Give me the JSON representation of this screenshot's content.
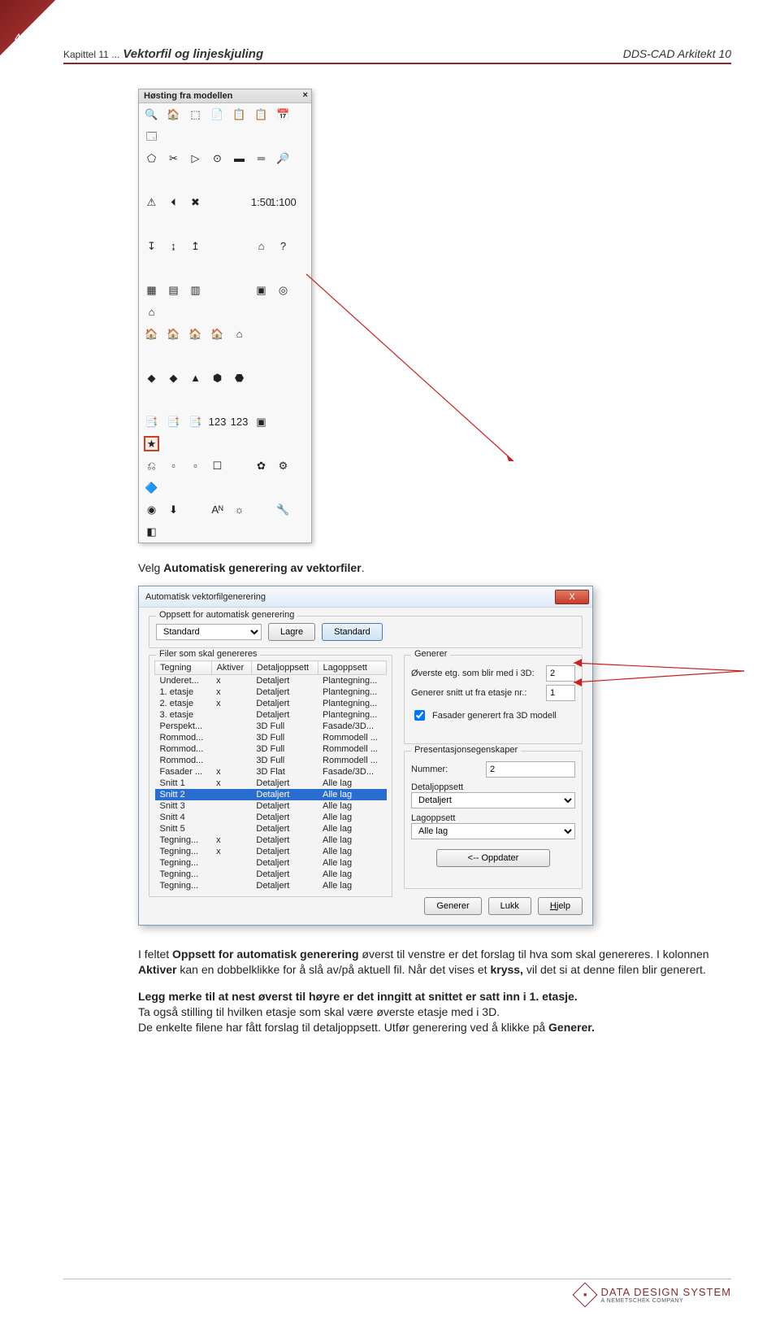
{
  "page_number": "4",
  "header": {
    "chapter": "Kapittel 11 ...",
    "title": "Vektorfil og linjeskjuling",
    "right": "DDS-CAD Arkitekt 10"
  },
  "toolbox": {
    "title": "Høsting fra modellen",
    "close": "×",
    "rows": [
      [
        "🔍",
        "🏠",
        "⬚",
        "📄",
        "📋",
        "📋",
        "📅",
        "🗔"
      ],
      [
        "⬠",
        "✂",
        "▷",
        "⊙",
        "▬",
        "═",
        "🔎",
        " "
      ],
      [
        "⚠",
        "⏴",
        "✖",
        " ",
        " ",
        "1:50",
        "1:100",
        " "
      ],
      [
        "↧",
        "↨",
        "↥",
        " ",
        " ",
        "⌂",
        "?",
        " "
      ],
      [
        "▦",
        "▤",
        "▥",
        " ",
        " ",
        "▣",
        "◎",
        "⌂"
      ],
      [
        "🏠",
        "🏠",
        "🏠",
        "🏠",
        "⌂",
        " ",
        " ",
        " "
      ],
      [
        "◆",
        "◆",
        "▲",
        "⬢",
        "⬣",
        " ",
        " ",
        " "
      ],
      [
        "📑",
        "📑",
        "📑",
        "123",
        "123",
        "▣",
        " ",
        "★"
      ],
      [
        "⎌",
        "▫",
        "▫",
        "☐",
        " ",
        "✿",
        "⚙",
        "🔷"
      ],
      [
        "◉",
        "⬇",
        " ",
        "Aᴺ",
        "☼",
        " ",
        "🔧",
        "◧"
      ]
    ],
    "highlight_index": [
      7,
      7
    ]
  },
  "caption_1": {
    "pre": "Velg ",
    "bold": "Automatisk generering av vektorfiler",
    "post": "."
  },
  "dialog": {
    "title": "Automatisk vektorfilgenerering",
    "close": "X",
    "gb_oppsett": "Oppsett for automatisk generering",
    "combo_standard": "Standard",
    "btn_lagre": "Lagre",
    "btn_standard": "Standard",
    "gb_filer": "Filer som skal genereres",
    "cols": [
      "Tegning",
      "Aktiver",
      "Detaljoppsett",
      "Lagoppsett"
    ],
    "rows": [
      [
        "Underet...",
        "x",
        "Detaljert",
        "Plantegning..."
      ],
      [
        "1. etasje",
        "x",
        "Detaljert",
        "Plantegning..."
      ],
      [
        "2. etasje",
        "x",
        "Detaljert",
        "Plantegning..."
      ],
      [
        "3. etasje",
        "",
        "Detaljert",
        "Plantegning..."
      ],
      [
        "Perspekt...",
        "",
        "3D Full",
        "Fasade/3D..."
      ],
      [
        "Rommod...",
        "",
        "3D Full",
        "Rommodell ..."
      ],
      [
        "Rommod...",
        "",
        "3D Full",
        "Rommodell ..."
      ],
      [
        "Rommod...",
        "",
        "3D Full",
        "Rommodell ..."
      ],
      [
        "Fasader ...",
        "x",
        "3D Flat",
        "Fasade/3D..."
      ],
      [
        "Snitt 1",
        "x",
        "Detaljert",
        "Alle lag"
      ],
      [
        "Snitt 2",
        "",
        "Detaljert",
        "Alle lag"
      ],
      [
        "Snitt 3",
        "",
        "Detaljert",
        "Alle lag"
      ],
      [
        "Snitt 4",
        "",
        "Detaljert",
        "Alle lag"
      ],
      [
        "Snitt 5",
        "",
        "Detaljert",
        "Alle lag"
      ],
      [
        "Tegning...",
        "x",
        "Detaljert",
        "Alle lag"
      ],
      [
        "Tegning...",
        "x",
        "Detaljert",
        "Alle lag"
      ],
      [
        "Tegning...",
        "",
        "Detaljert",
        "Alle lag"
      ],
      [
        "Tegning...",
        "",
        "Detaljert",
        "Alle lag"
      ],
      [
        "Tegning...",
        "",
        "Detaljert",
        "Alle lag"
      ]
    ],
    "selected_row_index": 10,
    "gb_generer": "Generer",
    "lbl_overste": "Øverste etg. som blir med i 3D:",
    "val_overste": "2",
    "lbl_snitt": "Generer snitt ut fra etasje nr.:",
    "val_snitt": "1",
    "chk_fasader": "Fasader generert fra 3D modell",
    "gb_pres": "Presentasjonsegenskaper",
    "lbl_nummer": "Nummer:",
    "val_nummer": "2",
    "lbl_detaljopp": "Detaljoppsett",
    "combo_detaljopp": "Detaljert",
    "lbl_lagopp": "Lagoppsett",
    "combo_lagopp": "Alle lag",
    "btn_oppdater": "<-- Oppdater",
    "btn_generer": "Generer",
    "btn_lukk": "Lukk",
    "btn_hjelp": "Hjelp"
  },
  "body": {
    "p1_a": "I feltet ",
    "p1_b": "Oppsett for automatisk generering",
    "p1_c": " øverst til venstre er det forslag til hva som skal genereres. I kolonnen ",
    "p1_d": "Aktiver",
    "p1_e": " kan en dobbelklikke for å slå av/på aktuell fil. Når det vises et ",
    "p1_f": "kryss,",
    "p1_g": " vil det si at denne filen blir generert.",
    "p2_a": "Legg merke til at nest øverst til høyre er det inngitt at snittet er satt inn i 1. etasje.",
    "p2_b": "Ta også stilling til hvilken etasje som skal være øverste etasje med i 3D.",
    "p2_c": "De enkelte filene har fått forslag til detaljoppsett. Utfør generering ved å klikke på ",
    "p2_d": "Generer."
  },
  "footer": {
    "brand_1": "DATA DESIGN SYSTEM",
    "brand_2": "A NEMETSCHEK COMPANY"
  }
}
